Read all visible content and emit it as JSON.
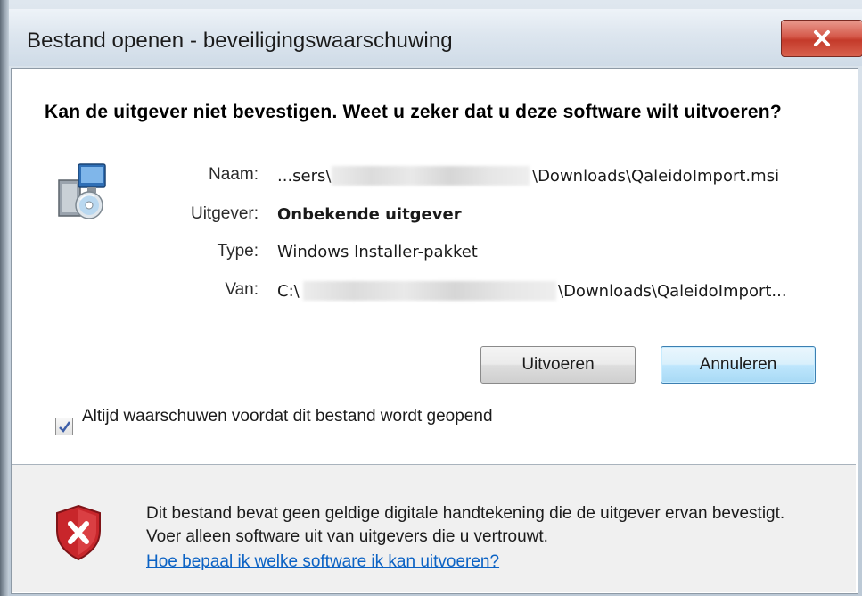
{
  "window": {
    "title": "Bestand openen - beveiligingswaarschuwing",
    "close_icon": "close-icon"
  },
  "dialog": {
    "headline": "Kan de uitgever niet bevestigen. Weet u zeker dat u deze software wilt uitvoeren?",
    "icon": "installer-package-icon",
    "fields": [
      {
        "label": "Naam:",
        "value_prefix": "...sers\\",
        "value_suffix": "\\Downloads\\QaleidoImport.msi"
      },
      {
        "label": "Uitgever:",
        "value": "Onbekende uitgever"
      },
      {
        "label": "Type:",
        "value": "Windows Installer-pakket"
      },
      {
        "label": "Van:",
        "value_prefix": "C:\\",
        "value_suffix": "\\Downloads\\QaleidoImport..."
      }
    ],
    "buttons": {
      "run_label": "Uitvoeren",
      "cancel_label": "Annuleren"
    },
    "checkbox": {
      "checked": true,
      "label": "Altijd waarschuwen voordat dit bestand wordt geopend"
    }
  },
  "footer": {
    "icon": "shield-error-icon",
    "text": "Dit bestand bevat geen geldige digitale handtekening die de uitgever ervan bevestigt. Voer alleen software uit van uitgevers die u vertrouwt.",
    "link": "Hoe bepaal ik welke software ik kan uitvoeren?"
  },
  "colors": {
    "link": "#0b62c4",
    "close_button": "#c43a2a",
    "default_button_border": "#3c7fb1",
    "footer_background": "#f0f0f0"
  }
}
